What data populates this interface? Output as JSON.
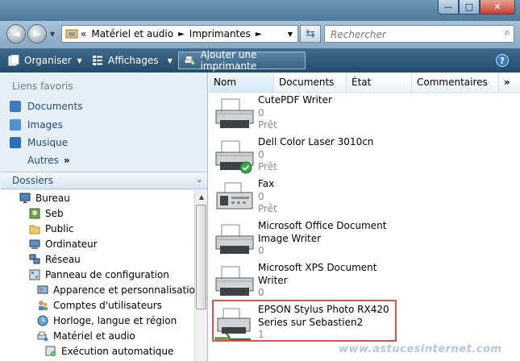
{
  "window": {
    "minimize_glyph": "—",
    "maximize_glyph": "□",
    "close_glyph": "✕"
  },
  "address": {
    "overflow": "«",
    "crumbs": [
      "Matériel et audio",
      "Imprimantes"
    ],
    "separator": "►"
  },
  "search": {
    "placeholder": "Rechercher"
  },
  "toolbar": {
    "organize": "Organiser",
    "views": "Affichages",
    "add_printer": "Ajouter une imprimante",
    "help": "?"
  },
  "favorites": {
    "title": "Liens favoris",
    "items": [
      "Documents",
      "Images",
      "Musique"
    ],
    "more": "Autres",
    "more_chevron": "»"
  },
  "folders": {
    "title": "Dossiers",
    "items": [
      {
        "label": "Bureau",
        "icon": "desktop-icon"
      },
      {
        "label": "Seb",
        "icon": "user-folder-icon"
      },
      {
        "label": "Public",
        "icon": "folder-icon"
      },
      {
        "label": "Ordinateur",
        "icon": "computer-icon"
      },
      {
        "label": "Réseau",
        "icon": "network-icon"
      },
      {
        "label": "Panneau de configuration",
        "icon": "control-panel-icon"
      },
      {
        "label": "Apparence et personnalisation",
        "icon": "appearance-icon"
      },
      {
        "label": "Comptes d'utilisateurs",
        "icon": "users-icon"
      },
      {
        "label": "Horloge, langue et région",
        "icon": "clock-globe-icon"
      },
      {
        "label": "Matériel et audio",
        "icon": "hardware-icon"
      },
      {
        "label": "Exécution automatique",
        "icon": "autoplay-icon"
      }
    ]
  },
  "columns": [
    "Nom",
    "Documents",
    "État",
    "Commentaires"
  ],
  "columns_overflow": "»",
  "printers": [
    {
      "name_lines": [
        "CutePDF Writer"
      ],
      "documents": "0",
      "status": "Prêt",
      "icon": "printer-icon"
    },
    {
      "name_lines": [
        "Dell Color Laser 3010cn"
      ],
      "documents": "0",
      "status": "Prêt",
      "icon": "default-printer-icon"
    },
    {
      "name_lines": [
        "Fax"
      ],
      "documents": "0",
      "status": "Prêt",
      "icon": "fax-icon"
    },
    {
      "name_lines": [
        "Microsoft Office Document",
        "Image Writer"
      ],
      "documents": "0",
      "status": "",
      "icon": "printer-icon"
    },
    {
      "name_lines": [
        "Microsoft XPS Document",
        "Writer"
      ],
      "documents": "0",
      "status": "",
      "icon": "printer-icon"
    },
    {
      "name_lines": [
        "EPSON Stylus Photo RX420",
        "Series sur Sebastien2"
      ],
      "documents": "1",
      "status": "",
      "icon": "network-printer-icon"
    }
  ],
  "watermark": "www.astucesinternet.com",
  "colors": {
    "highlight_border": "#d9534f",
    "link": "#1c4c8c",
    "toolbar": "#2f5a7c"
  }
}
